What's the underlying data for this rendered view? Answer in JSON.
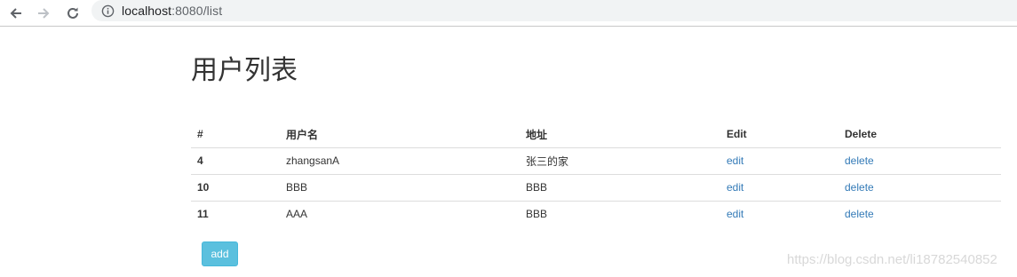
{
  "browser": {
    "url_host": "localhost",
    "url_rest": ":8080/list",
    "icons": {
      "back": "arrow-left-icon",
      "forward": "arrow-right-icon",
      "reload": "reload-icon",
      "info": "info-icon"
    }
  },
  "page": {
    "title": "用户列表"
  },
  "table": {
    "headers": [
      "#",
      "用户名",
      "地址",
      "Edit",
      "Delete"
    ],
    "rows": [
      {
        "id": "4",
        "username": "zhangsanA",
        "address": "张三的家",
        "edit": "edit",
        "delete": "delete"
      },
      {
        "id": "10",
        "username": "BBB",
        "address": "BBB",
        "edit": "edit",
        "delete": "delete"
      },
      {
        "id": "11",
        "username": "AAA",
        "address": "BBB",
        "edit": "edit",
        "delete": "delete"
      }
    ]
  },
  "actions": {
    "add_label": "add"
  },
  "watermark": "https://blog.csdn.net/li18782540852",
  "colors": {
    "link": "#337ab7",
    "add_button": "#5bc0de"
  }
}
